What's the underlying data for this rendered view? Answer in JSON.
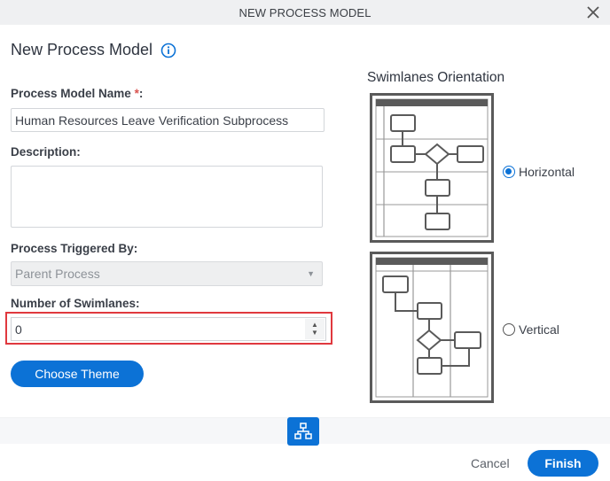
{
  "dialog": {
    "title": "NEW PROCESS MODEL",
    "close_icon": "close-icon"
  },
  "form": {
    "heading": "New Process Model",
    "info_icon": "info-icon",
    "name": {
      "label": "Process Model Name",
      "required_mark": "*",
      "label_suffix": ":",
      "value": "Human Resources Leave Verification Subprocess"
    },
    "description": {
      "label": "Description:",
      "value": ""
    },
    "triggered_by": {
      "label": "Process Triggered By:",
      "selected": "Parent Process",
      "disabled": true
    },
    "swimlanes": {
      "label": "Number of Swimlanes:",
      "value": "0"
    },
    "choose_theme_label": "Choose Theme"
  },
  "orientation": {
    "title": "Swimlanes Orientation",
    "options": [
      {
        "label": "Horizontal",
        "checked": true
      },
      {
        "label": "Vertical",
        "checked": false
      }
    ]
  },
  "toolbar": {
    "diagram_icon": "sitemap-icon"
  },
  "footer": {
    "cancel_label": "Cancel",
    "finish_label": "Finish"
  },
  "colors": {
    "accent": "#0c72d6",
    "highlight": "#e0383e",
    "required": "#d9534f"
  }
}
